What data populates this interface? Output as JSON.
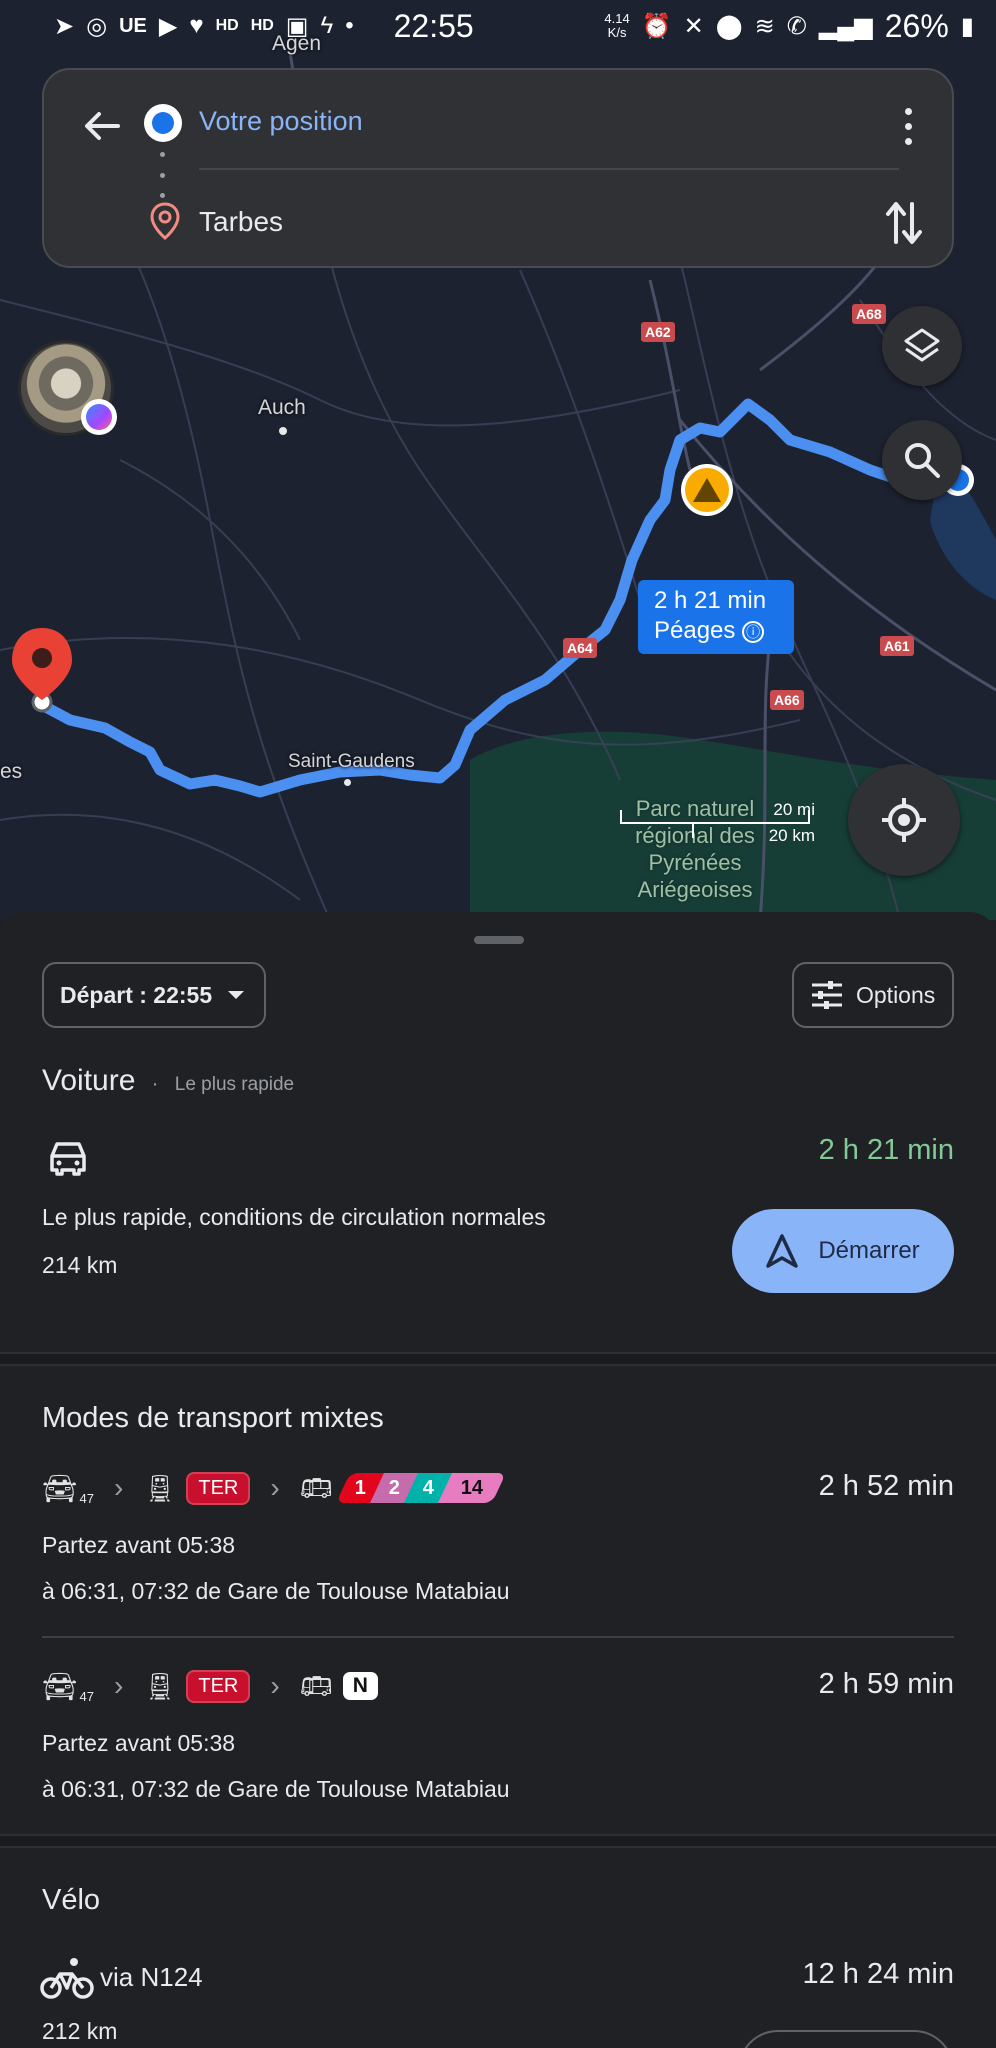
{
  "status_bar": {
    "time": "22:55",
    "net_speed_value": "4.14",
    "net_speed_unit": "K/s",
    "battery": "26%",
    "left_icon_text": "UE"
  },
  "search": {
    "origin": "Votre position",
    "destination": "Tarbes"
  },
  "map": {
    "labels": {
      "agen": "Agen",
      "auch": "Auch",
      "saint_gaudens": "Saint-Gaudens",
      "es": "es",
      "park": "Parc naturel régional des Pyrénées Ariégeoises"
    },
    "roads": [
      "A62",
      "A68",
      "A64",
      "A61",
      "A66"
    ],
    "callout": {
      "duration": "2 h 21 min",
      "tolls": "Péages"
    },
    "scale": {
      "mi": "20 mi",
      "km": "20 km"
    },
    "colors": {
      "route": "#4b8ff0",
      "background": "#1d2231",
      "park": "#16453a"
    }
  },
  "sheet": {
    "depart_label": "Départ : 22:55",
    "options_label": "Options",
    "car": {
      "title": "Voiture",
      "subtitle": "Le plus rapide",
      "duration": "2 h 21 min",
      "description": "Le plus rapide, conditions de circulation normales",
      "distance": "214 km",
      "start_label": "Démarrer"
    },
    "mixed": {
      "title": "Modes de transport mixtes",
      "options": [
        {
          "car_sub": "47",
          "train_badge": "TER",
          "lines": [
            {
              "label": "1",
              "color": "#e3051b"
            },
            {
              "label": "2",
              "color": "#c66bac"
            },
            {
              "label": "4",
              "color": "#00b2a9"
            },
            {
              "label": "14",
              "color": "#e87cc0"
            }
          ],
          "duration": "2 h 52 min",
          "leave_before": "Partez avant 05:38",
          "detail": "à 06:31, 07:32 de Gare de Toulouse Matabiau"
        },
        {
          "car_sub": "47",
          "train_badge": "TER",
          "bus_badge": "N",
          "duration": "2 h 59 min",
          "leave_before": "Partez avant 05:38",
          "detail": "à 06:31, 07:32 de Gare de Toulouse Matabiau"
        }
      ]
    },
    "bike": {
      "title": "Vélo",
      "via": "via N124",
      "duration": "12 h 24 min",
      "distance": "212 km"
    },
    "colors": {
      "accent_green": "#81c995",
      "start_button": "#8ab4f8",
      "ter_red": "#c8102e"
    }
  }
}
